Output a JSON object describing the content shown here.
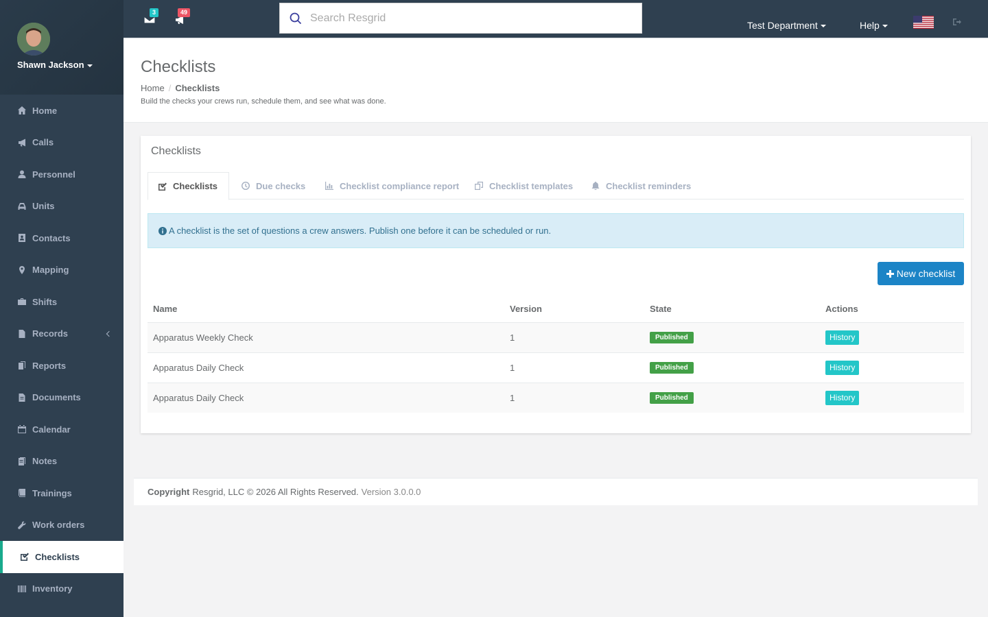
{
  "user": {
    "name": "Shawn Jackson"
  },
  "sidebar": {
    "items": [
      {
        "label": "Home",
        "icon": "home-icon"
      },
      {
        "label": "Calls",
        "icon": "bullhorn-icon"
      },
      {
        "label": "Personnel",
        "icon": "user-icon"
      },
      {
        "label": "Units",
        "icon": "truck-icon"
      },
      {
        "label": "Contacts",
        "icon": "address-book-icon"
      },
      {
        "label": "Mapping",
        "icon": "map-marker-icon"
      },
      {
        "label": "Shifts",
        "icon": "briefcase-icon"
      },
      {
        "label": "Records",
        "icon": "file-icon"
      },
      {
        "label": "Reports",
        "icon": "report-icon"
      },
      {
        "label": "Documents",
        "icon": "document-icon"
      },
      {
        "label": "Calendar",
        "icon": "calendar-icon"
      },
      {
        "label": "Notes",
        "icon": "notes-icon"
      },
      {
        "label": "Trainings",
        "icon": "book-icon"
      },
      {
        "label": "Work orders",
        "icon": "wrench-icon"
      },
      {
        "label": "Checklists",
        "icon": "checkbox-icon"
      },
      {
        "label": "Inventory",
        "icon": "barcode-icon"
      }
    ],
    "active_index": 14
  },
  "topbar": {
    "messages_count": "3",
    "messages_badge_color": "#23c6c8",
    "notifications_count": "49",
    "notifications_badge_color": "#ed5565",
    "search_placeholder": "Search Resgrid",
    "department": "Test Department",
    "help": "Help"
  },
  "page": {
    "title": "Checklists",
    "breadcrumb_home": "Home",
    "breadcrumb_current": "Checklists",
    "subtitle": "Build the checks your crews run, schedule them, and see what was done."
  },
  "panel": {
    "title": "Checklists",
    "tabs": [
      {
        "label": "Checklists",
        "icon": "checkbox-icon"
      },
      {
        "label": "Due checks",
        "icon": "clock-icon"
      },
      {
        "label": "Checklist compliance report",
        "icon": "bar-chart-icon"
      },
      {
        "label": "Checklist templates",
        "icon": "copy-icon"
      },
      {
        "label": "Checklist reminders",
        "icon": "bell-icon"
      }
    ],
    "alert": "A checklist is the set of questions a crew answers. Publish one before it can be scheduled or run.",
    "new_button": "New checklist"
  },
  "table": {
    "headers": {
      "name": "Name",
      "version": "Version",
      "state": "State",
      "actions": "Actions"
    },
    "rows": [
      {
        "name": "Apparatus Weekly Check",
        "version": "1",
        "state": "Published",
        "action": "History"
      },
      {
        "name": "Apparatus Daily Check",
        "version": "1",
        "state": "Published",
        "action": "History"
      },
      {
        "name": "Apparatus Daily Check",
        "version": "1",
        "state": "Published",
        "action": "History"
      }
    ]
  },
  "footer": {
    "copyright_label": "Copyright",
    "copyright_text": "Resgrid, LLC © 2026 All Rights Reserved.",
    "version": "Version 3.0.0.0"
  }
}
